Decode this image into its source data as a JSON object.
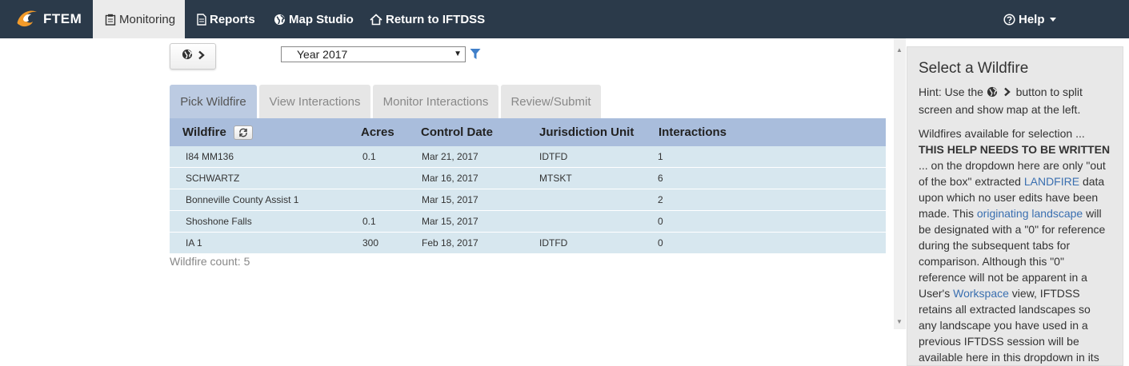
{
  "nav": {
    "brand": "FTEM",
    "items": [
      {
        "label": "Monitoring",
        "icon": "clipboard-icon"
      },
      {
        "label": "Reports",
        "icon": "document-icon"
      },
      {
        "label": "Map Studio",
        "icon": "globe-icon"
      },
      {
        "label": "Return to IFTDSS",
        "icon": "home-icon"
      }
    ],
    "help_label": "Help"
  },
  "toolbar": {
    "year_select_value": "Year 2017"
  },
  "tabs": [
    {
      "label": "Pick Wildfire",
      "active": true
    },
    {
      "label": "View Interactions"
    },
    {
      "label": "Monitor Interactions"
    },
    {
      "label": "Review/Submit"
    }
  ],
  "table": {
    "columns": [
      "Wildfire",
      "Acres",
      "Control Date",
      "Jurisdiction Unit",
      "Interactions"
    ],
    "rows": [
      [
        "I84 MM136",
        "0.1",
        "Mar 21, 2017",
        "IDTFD",
        "1"
      ],
      [
        "SCHWARTZ",
        "",
        "Mar 16, 2017",
        "MTSKT",
        "6"
      ],
      [
        "Bonneville County Assist 1",
        "",
        "Mar 15, 2017",
        "",
        "2"
      ],
      [
        "Shoshone Falls",
        "0.1",
        "Mar 15, 2017",
        "",
        "0"
      ],
      [
        "IA 1",
        "300",
        "Feb 18, 2017",
        "IDTFD",
        "0"
      ]
    ],
    "count_text": "Wildfire count: 5"
  },
  "help": {
    "title": "Select a Wildfire",
    "hint_prefix": "Hint: Use the",
    "hint_suffix": "button to split screen and show map at the left.",
    "p2_start": "Wildfires available for selection ...",
    "p2_bold": "THIS HELP NEEDS TO BE WRITTEN",
    "p2_a": "... on the dropdown here are only \"out of the box\" extracted",
    "link_landfire": "LANDFIRE",
    "p2_b": "data upon which no user edits have been made. This",
    "link_originating": "originating landscape",
    "p2_c": "will be designated with a \"0\" for reference during the subsequent tabs for comparison. Although this \"0\" reference will not be apparent in a User's",
    "link_workspace": "Workspace",
    "p2_d": "view, IFTDSS retains all extracted landscapes so any landscape you have used in a previous IFTDSS session will be available here in this dropdown in its"
  },
  "colors": {
    "navbar": "#2b3a4a",
    "tab_active": "#bccbe2",
    "table_header": "#a9bddc",
    "table_body": "#d7e7ef",
    "link": "#3a6fb0"
  }
}
